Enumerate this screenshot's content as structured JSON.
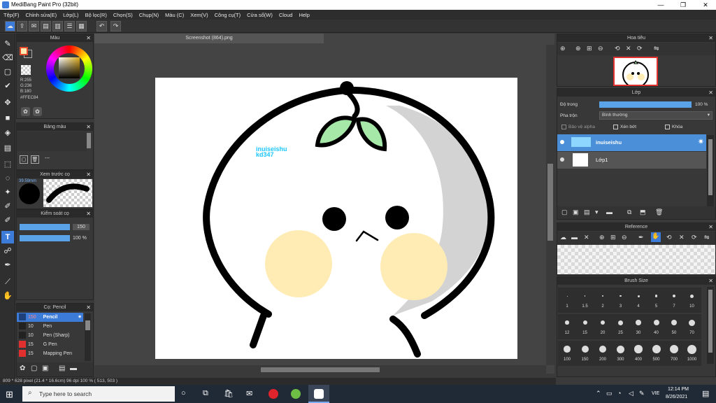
{
  "app": {
    "title": "MediBang Paint Pro (32bit)"
  },
  "window_buttons": {
    "minimize": "—",
    "maximize": "❐",
    "close": "✕"
  },
  "menu": [
    "Tệp(F)",
    "Chỉnh sửa(E)",
    "Lớp(L)",
    "Bộ lọc(R)",
    "Chọn(S)",
    "Chụp(N)",
    "Màu (C)",
    "Xem(V)",
    "Công cụ(T)",
    "Cửa sổ(W)",
    "Cloud",
    "Help"
  ],
  "document": {
    "tab_title": "Screenshot (864).png"
  },
  "color_panel": {
    "title": "Màu",
    "r": "R:255",
    "g": "G:236",
    "b": "B:180",
    "hex": "#FFEC84",
    "fg_color": "#ffecb4",
    "bg_color": "#ffffff"
  },
  "palette_panel": {
    "title": "Bảng màu",
    "empty": "---"
  },
  "brush_preview": {
    "title": "Xem trước cọ",
    "size": "39.59mm"
  },
  "brush_control": {
    "title": "Kiểm soát cọ",
    "size_value": "150",
    "opacity_value": "100 %"
  },
  "brush_list": {
    "title": "Cọ: Pencil",
    "items": [
      {
        "size": "150",
        "name": "Pencil",
        "color": "#3a6ab8"
      },
      {
        "size": "10",
        "name": "Pen",
        "color": "#222"
      },
      {
        "size": "10",
        "name": "Pen (Sharp)",
        "color": "#222"
      },
      {
        "size": "15",
        "name": "G Pen",
        "color": "#e03030"
      },
      {
        "size": "15",
        "name": "Mapping Pen",
        "color": "#e03030"
      }
    ]
  },
  "navigator": {
    "title": "Hoa tiêu"
  },
  "layer_panel": {
    "title": "Lớp",
    "opacity_label": "Độ trong",
    "opacity_value": "100 %",
    "blend_label": "Pha trộn",
    "blend_value": "Bình thường",
    "protect_alpha": "Bảo vệ alpha",
    "clipping": "Xén bớt",
    "lock": "Khóa",
    "layers": [
      {
        "name": "inuiseishu",
        "selected": true
      },
      {
        "name": "Lớp1",
        "selected": false
      }
    ]
  },
  "reference_panel": {
    "title": "Reference"
  },
  "brush_size_panel": {
    "title": "Brush Size",
    "sizes": [
      "1",
      "1.5",
      "2",
      "3",
      "4",
      "5",
      "7",
      "10",
      "12",
      "15",
      "20",
      "25",
      "30",
      "40",
      "50",
      "70",
      "100",
      "150",
      "200",
      "300",
      "400",
      "500",
      "700",
      "1000"
    ]
  },
  "canvas_text": {
    "line1": "inuiseishu",
    "line2": "kd347"
  },
  "status": {
    "text": "809 * 628 pixel  (21.4 * 16.6cm)  96 dpi  100 %  ( 513, 503 )"
  },
  "taskbar": {
    "search_placeholder": "Type here to search",
    "lang": "VIE",
    "time": "12:14 PM",
    "date": "8/26/2021"
  }
}
